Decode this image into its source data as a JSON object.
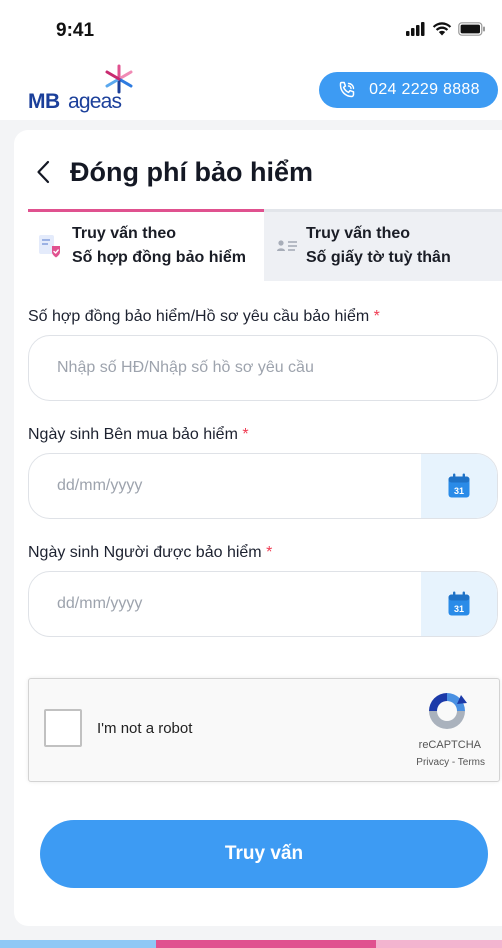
{
  "status_bar": {
    "time": "9:41"
  },
  "header": {
    "logo_mb": "MB",
    "logo_ageas": "ageas",
    "hotline": "024 2229 8888"
  },
  "page": {
    "title": "Đóng phí bảo hiểm"
  },
  "tabs": [
    {
      "line1": "Truy vấn theo",
      "line2": "Số hợp đồng bảo hiểm",
      "active": true
    },
    {
      "line1": "Truy vấn theo",
      "line2": "Số giấy tờ tuỳ thân",
      "active": false
    }
  ],
  "form": {
    "contract": {
      "label": "Số hợp đồng bảo hiểm/Hồ sơ yêu cầu bảo hiểm",
      "required_mark": "*",
      "placeholder": "Nhập số HĐ/Nhập số hồ sơ yêu cầu"
    },
    "buyer_dob": {
      "label": "Ngày sinh Bên mua bảo hiểm",
      "required_mark": "*",
      "placeholder": "dd/mm/yyyy"
    },
    "insured_dob": {
      "label": "Ngày sinh Người được bảo hiểm",
      "required_mark": "*",
      "placeholder": "dd/mm/yyyy"
    },
    "calendar_day": "31"
  },
  "captcha": {
    "label": "I'm not a robot",
    "brand": "reCAPTCHA",
    "links": "Privacy - Terms"
  },
  "submit": {
    "label": "Truy vấn"
  },
  "colors": {
    "primary": "#3d9bf3",
    "accent": "#e0518f",
    "required": "#ef3b52",
    "brand_navy": "#1b3f9a"
  }
}
